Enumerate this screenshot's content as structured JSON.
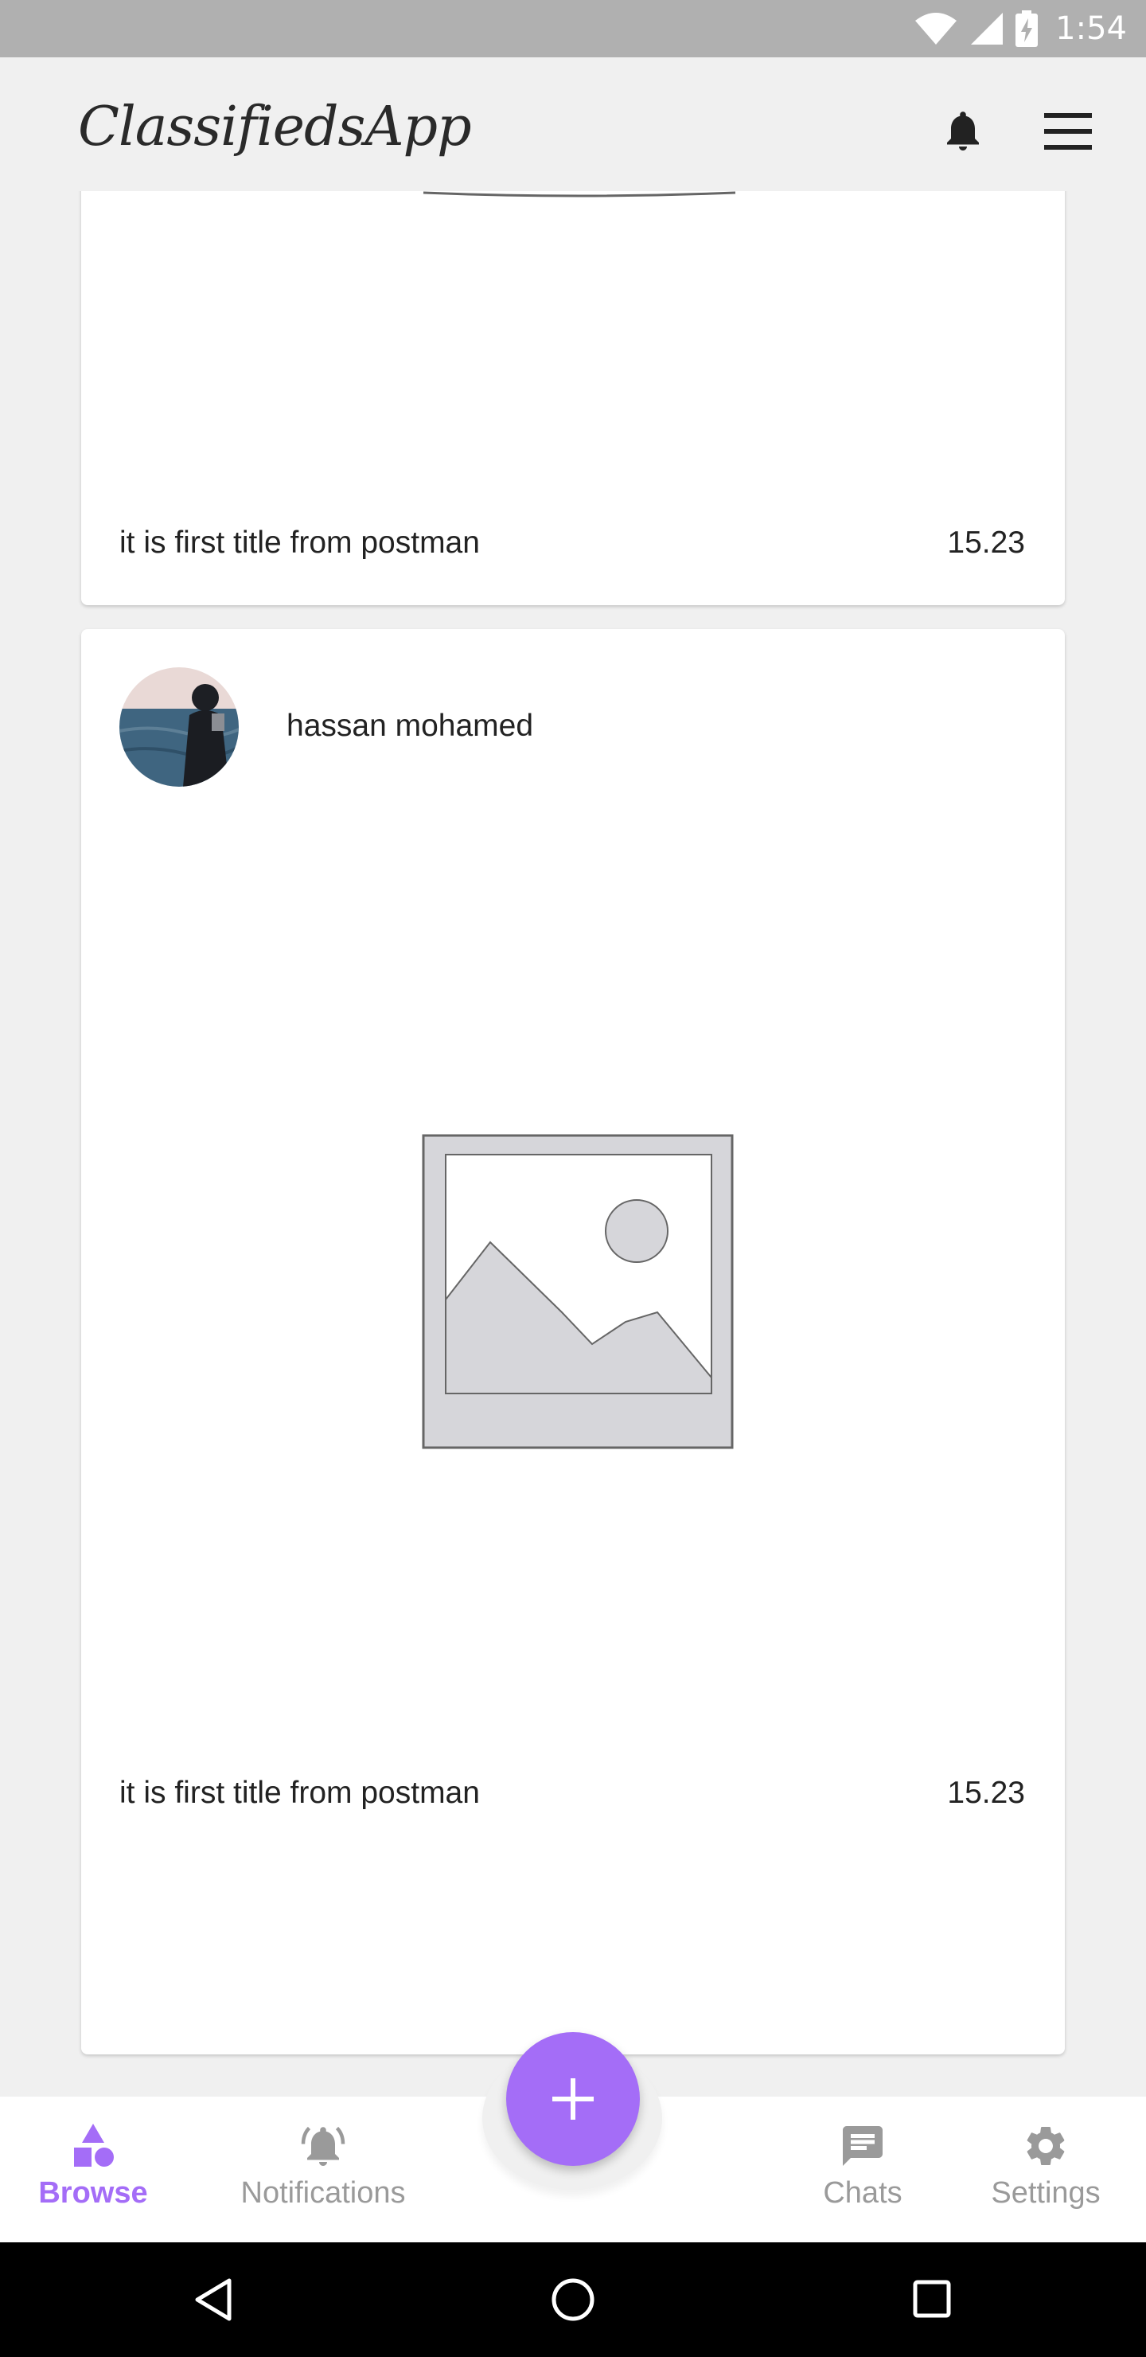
{
  "status_bar": {
    "time": "1:54"
  },
  "app_bar": {
    "title": "ClassifiedsApp"
  },
  "ads": [
    {
      "title": "it is first title from postman",
      "price": "15.23"
    },
    {
      "owner": "hassan mohamed",
      "title": "it is first title from postman",
      "price": "15.23"
    }
  ],
  "bottom_nav": {
    "items": [
      {
        "label": "Browse",
        "icon": "browse-icon"
      },
      {
        "label": "Notifications",
        "icon": "bell-ring-icon"
      },
      {
        "label": "Chats",
        "icon": "chat-icon"
      },
      {
        "label": "Settings",
        "icon": "gear-icon"
      }
    ],
    "fab_icon": "plus-icon"
  },
  "colors": {
    "accent": "#a46df7",
    "inactive": "#9a9a9a",
    "background": "#f0f0f0"
  }
}
